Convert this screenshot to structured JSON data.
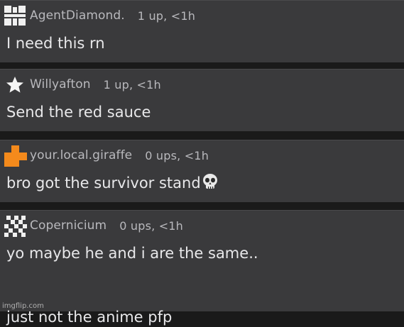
{
  "comments": [
    {
      "avatar_icon": "grid-pixel-icon",
      "username": "AgentDiamond.",
      "meta": "1 up, <1h",
      "text": "I need this rn"
    },
    {
      "avatar_icon": "star-icon",
      "username": "Willyafton",
      "meta": "1 up, <1h",
      "text": "Send the red sauce"
    },
    {
      "avatar_icon": "orange-plus-icon",
      "username": "your.local.giraffe",
      "meta": "0 ups, <1h",
      "text": "bro got the survivor stand",
      "emoji": "skull-emoji"
    },
    {
      "avatar_icon": "checker-pixel-icon",
      "username": "Copernicium",
      "meta": "0 ups, <1h",
      "text_line1": "yo maybe he and i are the same..",
      "text_line2": "just not the anime pfp"
    }
  ],
  "watermark": "imgflip.com",
  "colors": {
    "background": "#1a1a1a",
    "card": "#3a3a3c",
    "meta_text": "#b9b9bd",
    "body_text": "#e8e8ea",
    "accent_orange": "#f48a1c"
  }
}
